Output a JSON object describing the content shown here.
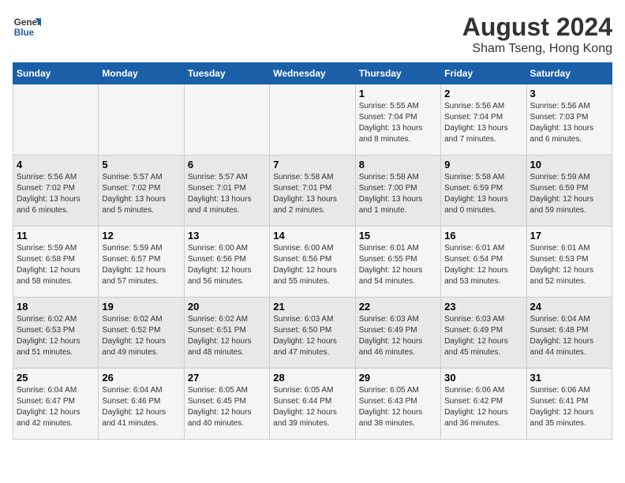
{
  "logo": {
    "line1": "General",
    "line2": "Blue"
  },
  "title": "August 2024",
  "subtitle": "Sham Tseng, Hong Kong",
  "days_of_week": [
    "Sunday",
    "Monday",
    "Tuesday",
    "Wednesday",
    "Thursday",
    "Friday",
    "Saturday"
  ],
  "weeks": [
    [
      {
        "day": "",
        "info": ""
      },
      {
        "day": "",
        "info": ""
      },
      {
        "day": "",
        "info": ""
      },
      {
        "day": "",
        "info": ""
      },
      {
        "day": "1",
        "info": "Sunrise: 5:55 AM\nSunset: 7:04 PM\nDaylight: 13 hours\nand 8 minutes."
      },
      {
        "day": "2",
        "info": "Sunrise: 5:56 AM\nSunset: 7:04 PM\nDaylight: 13 hours\nand 7 minutes."
      },
      {
        "day": "3",
        "info": "Sunrise: 5:56 AM\nSunset: 7:03 PM\nDaylight: 13 hours\nand 6 minutes."
      }
    ],
    [
      {
        "day": "4",
        "info": "Sunrise: 5:56 AM\nSunset: 7:02 PM\nDaylight: 13 hours\nand 6 minutes."
      },
      {
        "day": "5",
        "info": "Sunrise: 5:57 AM\nSunset: 7:02 PM\nDaylight: 13 hours\nand 5 minutes."
      },
      {
        "day": "6",
        "info": "Sunrise: 5:57 AM\nSunset: 7:01 PM\nDaylight: 13 hours\nand 4 minutes."
      },
      {
        "day": "7",
        "info": "Sunrise: 5:58 AM\nSunset: 7:01 PM\nDaylight: 13 hours\nand 2 minutes."
      },
      {
        "day": "8",
        "info": "Sunrise: 5:58 AM\nSunset: 7:00 PM\nDaylight: 13 hours\nand 1 minute."
      },
      {
        "day": "9",
        "info": "Sunrise: 5:58 AM\nSunset: 6:59 PM\nDaylight: 13 hours\nand 0 minutes."
      },
      {
        "day": "10",
        "info": "Sunrise: 5:59 AM\nSunset: 6:59 PM\nDaylight: 12 hours\nand 59 minutes."
      }
    ],
    [
      {
        "day": "11",
        "info": "Sunrise: 5:59 AM\nSunset: 6:58 PM\nDaylight: 12 hours\nand 58 minutes."
      },
      {
        "day": "12",
        "info": "Sunrise: 5:59 AM\nSunset: 6:57 PM\nDaylight: 12 hours\nand 57 minutes."
      },
      {
        "day": "13",
        "info": "Sunrise: 6:00 AM\nSunset: 6:56 PM\nDaylight: 12 hours\nand 56 minutes."
      },
      {
        "day": "14",
        "info": "Sunrise: 6:00 AM\nSunset: 6:56 PM\nDaylight: 12 hours\nand 55 minutes."
      },
      {
        "day": "15",
        "info": "Sunrise: 6:01 AM\nSunset: 6:55 PM\nDaylight: 12 hours\nand 54 minutes."
      },
      {
        "day": "16",
        "info": "Sunrise: 6:01 AM\nSunset: 6:54 PM\nDaylight: 12 hours\nand 53 minutes."
      },
      {
        "day": "17",
        "info": "Sunrise: 6:01 AM\nSunset: 6:53 PM\nDaylight: 12 hours\nand 52 minutes."
      }
    ],
    [
      {
        "day": "18",
        "info": "Sunrise: 6:02 AM\nSunset: 6:53 PM\nDaylight: 12 hours\nand 51 minutes."
      },
      {
        "day": "19",
        "info": "Sunrise: 6:02 AM\nSunset: 6:52 PM\nDaylight: 12 hours\nand 49 minutes."
      },
      {
        "day": "20",
        "info": "Sunrise: 6:02 AM\nSunset: 6:51 PM\nDaylight: 12 hours\nand 48 minutes."
      },
      {
        "day": "21",
        "info": "Sunrise: 6:03 AM\nSunset: 6:50 PM\nDaylight: 12 hours\nand 47 minutes."
      },
      {
        "day": "22",
        "info": "Sunrise: 6:03 AM\nSunset: 6:49 PM\nDaylight: 12 hours\nand 46 minutes."
      },
      {
        "day": "23",
        "info": "Sunrise: 6:03 AM\nSunset: 6:49 PM\nDaylight: 12 hours\nand 45 minutes."
      },
      {
        "day": "24",
        "info": "Sunrise: 6:04 AM\nSunset: 6:48 PM\nDaylight: 12 hours\nand 44 minutes."
      }
    ],
    [
      {
        "day": "25",
        "info": "Sunrise: 6:04 AM\nSunset: 6:47 PM\nDaylight: 12 hours\nand 42 minutes."
      },
      {
        "day": "26",
        "info": "Sunrise: 6:04 AM\nSunset: 6:46 PM\nDaylight: 12 hours\nand 41 minutes."
      },
      {
        "day": "27",
        "info": "Sunrise: 6:05 AM\nSunset: 6:45 PM\nDaylight: 12 hours\nand 40 minutes."
      },
      {
        "day": "28",
        "info": "Sunrise: 6:05 AM\nSunset: 6:44 PM\nDaylight: 12 hours\nand 39 minutes."
      },
      {
        "day": "29",
        "info": "Sunrise: 6:05 AM\nSunset: 6:43 PM\nDaylight: 12 hours\nand 38 minutes."
      },
      {
        "day": "30",
        "info": "Sunrise: 6:06 AM\nSunset: 6:42 PM\nDaylight: 12 hours\nand 36 minutes."
      },
      {
        "day": "31",
        "info": "Sunrise: 6:06 AM\nSunset: 6:41 PM\nDaylight: 12 hours\nand 35 minutes."
      }
    ]
  ]
}
